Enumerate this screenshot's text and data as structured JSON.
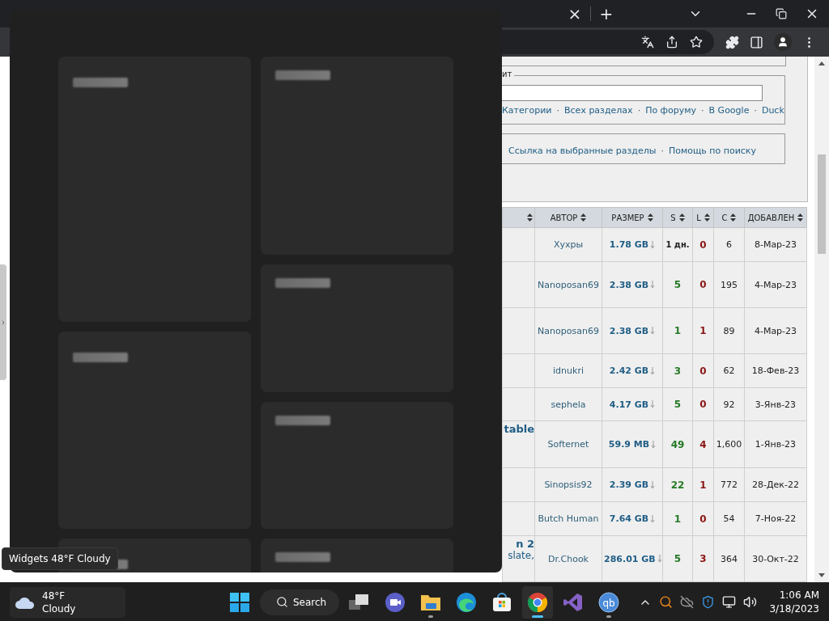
{
  "browser": {
    "tab_close": "×",
    "new_tab": "+"
  },
  "search_box": {
    "legend": "ит",
    "links": [
      {
        "kind": "link",
        "text": "Категории"
      },
      {
        "kind": "sep",
        "text": "·"
      },
      {
        "kind": "link",
        "text": "Всех разделах"
      },
      {
        "kind": "sep",
        "text": "·"
      },
      {
        "kind": "link",
        "text": "По форуму"
      },
      {
        "kind": "sep",
        "text": "·"
      },
      {
        "kind": "link",
        "text": "В Google"
      },
      {
        "kind": "sep",
        "text": "·"
      },
      {
        "kind": "link",
        "text": "Duck"
      }
    ]
  },
  "extra_links": [
    {
      "kind": "link",
      "text": "Ссылка на выбранные разделы"
    },
    {
      "kind": "sep",
      "text": "·"
    },
    {
      "kind": "link",
      "text": "Помощь по поиску"
    }
  ],
  "table": {
    "columns": [
      "АВТОР",
      "РАЗМЕР",
      "S",
      "L",
      "C",
      "ДОБАВЛЕН"
    ],
    "rows": [
      {
        "author": "Хухры",
        "size": "1.78 GB",
        "seeds": "1 дн.",
        "stale": true,
        "leech": "0",
        "comments": "6",
        "added": "8-Мар-23"
      },
      {
        "author": "Nanoposan69",
        "size": "2.38 GB",
        "seeds": "5",
        "stale": false,
        "leech": "0",
        "comments": "195",
        "added": "4-Мар-23"
      },
      {
        "author": "Nanoposan69",
        "size": "2.38 GB",
        "seeds": "1",
        "stale": false,
        "leech": "1",
        "comments": "89",
        "added": "4-Мар-23"
      },
      {
        "author": "idnukri",
        "size": "2.42 GB",
        "seeds": "3",
        "stale": false,
        "leech": "0",
        "comments": "62",
        "added": "18-Фев-23"
      },
      {
        "author": "sephela",
        "size": "4.17 GB",
        "seeds": "5",
        "stale": false,
        "leech": "0",
        "comments": "92",
        "added": "3-Янв-23"
      },
      {
        "title": "table",
        "author": "Softernet",
        "size": "59.9 MB",
        "seeds": "49",
        "stale": false,
        "leech": "4",
        "comments": "1,600",
        "added": "1-Янв-23"
      },
      {
        "author": "Sinopsis92",
        "size": "2.39 GB",
        "seeds": "22",
        "stale": false,
        "leech": "1",
        "comments": "772",
        "added": "28-Дек-22"
      },
      {
        "author": "Butch Human",
        "size": "7.64 GB",
        "seeds": "1",
        "stale": false,
        "leech": "0",
        "comments": "54",
        "added": "7-Ноя-22"
      },
      {
        "title": "n 2",
        "subtitle": "slate,",
        "author": "Dr.Chook",
        "size": "286.01 GB",
        "seeds": "5",
        "stale": false,
        "leech": "3",
        "comments": "364",
        "added": "30-Окт-22"
      }
    ]
  },
  "tooltip": "Widgets 48°F Cloudy",
  "taskbar": {
    "weather": {
      "temp": "48°F",
      "condition": "Cloudy"
    },
    "search": "Search",
    "apps": [
      {
        "kind": "taskview",
        "running": false,
        "active": false
      },
      {
        "kind": "meet",
        "running": false,
        "active": false
      },
      {
        "kind": "files",
        "running": true,
        "active": false
      },
      {
        "kind": "edge",
        "running": false,
        "active": false
      },
      {
        "kind": "store",
        "running": false,
        "active": false
      },
      {
        "kind": "chrome",
        "running": true,
        "active": true
      },
      {
        "kind": "studio",
        "running": false,
        "active": false
      },
      {
        "kind": "qb",
        "label": "qb",
        "running": true,
        "active": false
      }
    ],
    "time": "1:06 AM",
    "date": "3/18/2023"
  }
}
